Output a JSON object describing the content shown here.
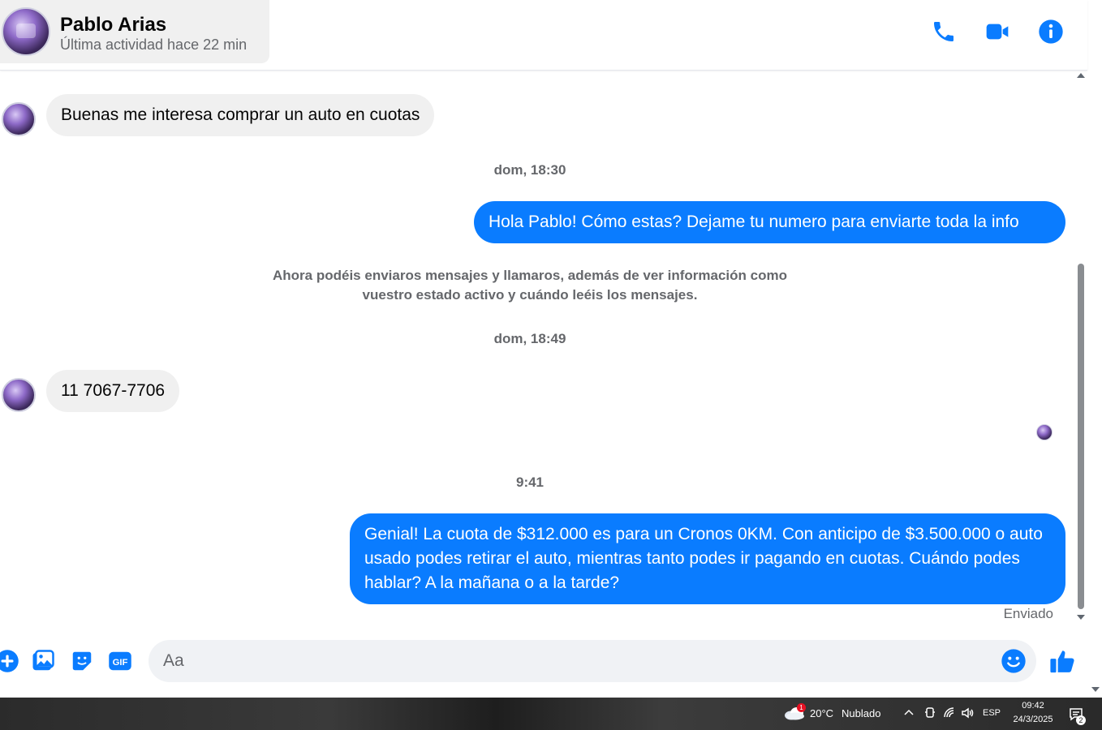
{
  "header": {
    "contact_name": "Pablo Arias",
    "contact_status": "Última actividad hace 22 min",
    "icons": [
      "phone-icon",
      "video-icon",
      "info-icon"
    ]
  },
  "messages": {
    "m1": "Buenas me interesa comprar un auto en cuotas",
    "ts1": "dom, 18:30",
    "m2": "Hola Pablo! Cómo estas? Dejame tu numero para enviarte toda la info",
    "system_note_line1": "Ahora podéis enviaros mensajes y llamaros, además de ver información como",
    "system_note_line2": "vuestro estado activo y cuándo leéis los mensajes.",
    "ts2": "dom, 18:49",
    "m3": "11 7067-7706",
    "ts3": "9:41",
    "m4": "Genial! La cuota de $312.000 es para un Cronos 0KM. Con anticipo de $3.500.000 o auto usado podes retirar el auto, mientras tanto podes ir pagando en cuotas. Cuándo podes hablar? A la mañana o a la tarde?",
    "status": "Enviado"
  },
  "composer": {
    "placeholder": "Aa",
    "icons": [
      "plus-icon",
      "image-icon",
      "sticker-icon",
      "gif-icon",
      "emoji-icon",
      "thumbs-up-icon"
    ]
  },
  "taskbar": {
    "weather_badge": "1",
    "temperature": "20°C",
    "weather": "Nublado",
    "language": "ESP",
    "time": "09:42",
    "date": "24/3/2025",
    "notifications": "2"
  },
  "colors": {
    "accent": "#0a7cff",
    "incoming_bubble": "#f0f0f0",
    "muted_text": "#65676b"
  }
}
